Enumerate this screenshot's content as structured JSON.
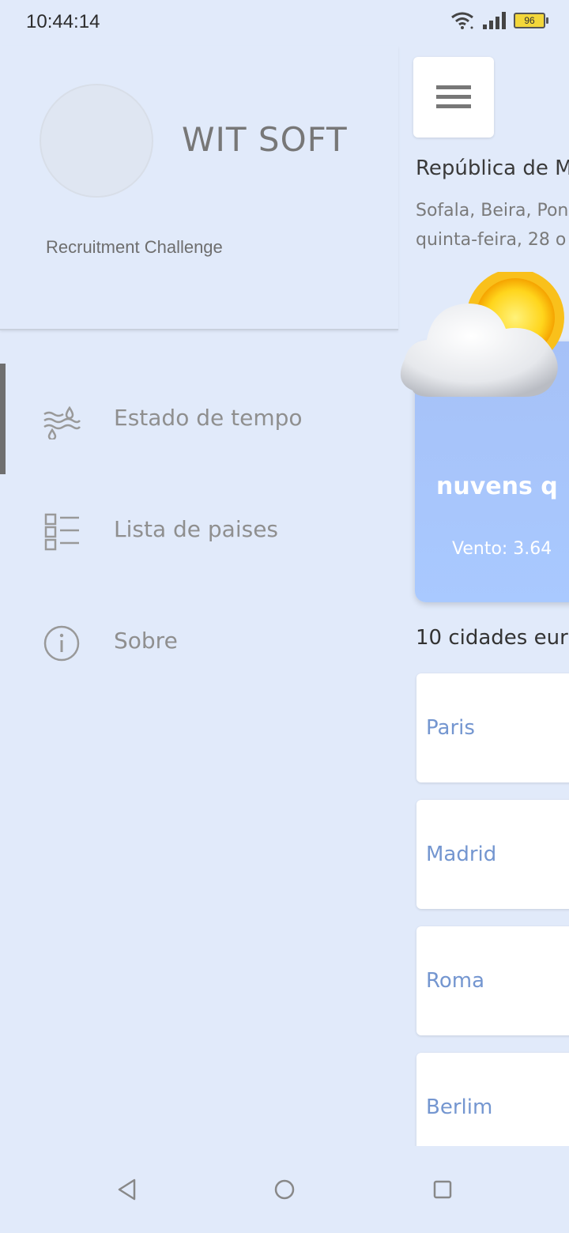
{
  "status_bar": {
    "time": "10:44:14",
    "battery": "96",
    "icons": [
      "wifi-icon",
      "signal-icon",
      "battery-icon"
    ]
  },
  "drawer": {
    "brand": "WIT SOFT",
    "subtitle": "Recruitment Challenge",
    "items": [
      {
        "label": "Estado de tempo",
        "icon": "weather-icon",
        "active": true
      },
      {
        "label": "Lista de paises",
        "icon": "list-icon",
        "active": false
      },
      {
        "label": "Sobre",
        "icon": "info-icon",
        "active": false
      }
    ]
  },
  "main": {
    "country": "República de M",
    "location": "Sofala, Beira, Pon",
    "date": "quinta-feira, 28 o",
    "weather": {
      "description": "nuvens q",
      "wind": "Vento: 3.64",
      "icon": "partly-cloudy-icon"
    },
    "cities_title": "10 cidades eur",
    "cities": [
      "Paris",
      "Madrid",
      "Roma",
      "Berlim"
    ]
  },
  "colors": {
    "background": "#e1eafa",
    "weather_card": "#a9c9ff",
    "city_text": "#7496d0"
  }
}
